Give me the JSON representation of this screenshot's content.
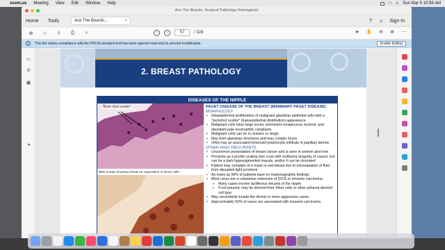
{
  "menubar": {
    "app": "zoom.us",
    "items": [
      "Meeting",
      "View",
      "Edit",
      "Window",
      "Help"
    ],
    "datetime": "Sun Mar 5  10:58 AM"
  },
  "window": {
    "title": "Ace The Boards- Surgical Pathology Reimagined"
  },
  "tabs": {
    "home": "Home",
    "tools": "Tools",
    "doc": "Ace The Boards...",
    "sign_in": "Sign In"
  },
  "toolbar": {
    "page_current": "57",
    "page_total": "/ 328"
  },
  "notice": {
    "text": "This file claims compliance with the PDF/A standard and has been opened read-only to prevent modification.",
    "button": "Enable Editing"
  },
  "page": {
    "banner_title": "2. BREAST PATHOLOGY",
    "section_header": "DISEASES OF THE NIPPLE",
    "image1_caption": "“Buck-shot scatter”",
    "image2_caption": "BNC-5 stain showing clonal CK expression in tumor cells",
    "heading": "PAGET DISEASE OF THE BREAST (MAMMARY PAGET DISEASE)",
    "morphology_label": "MORPHOLOGY",
    "morphology": [
      "Intraepidermal proliferation of malignant glandular epithelial cells with a “buckshot scatter” (transepidermal distribution) appearance",
      "Malignant cells have large nuclei, prominent conspicuous nucleoli, and abundant pale eosinophilic cytoplasm",
      "Malignant cells can be in clusters or singly",
      "May form glandular structures and may contain mucin",
      "Often has an associated lichenoid lymphocytic infiltrate in papillary dermis"
    ],
    "other_label": "OTHER HIGH YIELD POINTS",
    "other": [
      "Uncommon presentation of breast cancer and is seen in women and men",
      "Presents as a pruritic scaling skin crust with erythema (majority of cases), but can be a dark hyperpigmented macule, and/or it can be ulcerated",
      "Patient may complain of a moist or wet-breast due to extravasation of fluid from disrupted tight junctions",
      "As many as 50% of patients have no mammographic findings",
      "Most cases are a cutaneous extension of DCIS or invasive carcinoma"
    ],
    "sub": [
      "Many cases involve lactiferous sinuses of the nipple",
      "If not present, may be derived from Toker cells or other adnexal-derived cell type"
    ],
    "other2": [
      "May secondarily invade the dermis in more aggressive cases",
      "Approximately 50% of cases are associated with invasive carcinoma"
    ]
  }
}
